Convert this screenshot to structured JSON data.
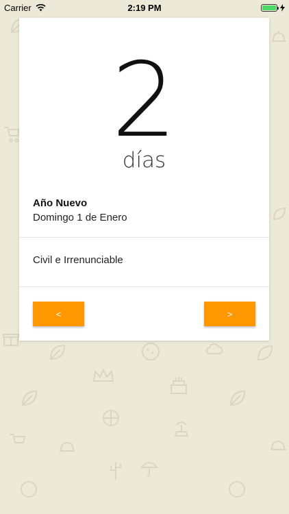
{
  "status_bar": {
    "carrier": "Carrier",
    "time": "2:19 PM",
    "wifi_icon": "wifi-icon",
    "battery_icon": "battery-icon",
    "charging_icon": "bolt-icon",
    "battery_level": 1.0
  },
  "card": {
    "days_count": "2",
    "days_label": "días",
    "holiday": {
      "name": "Año Nuevo",
      "date": "Domingo 1 de Enero",
      "type": "Civil e Irrenunciable"
    },
    "prev_label": "<",
    "next_label": ">"
  },
  "colors": {
    "background": "#ede9d8",
    "accent": "#ff9800",
    "card": "#ffffff"
  }
}
